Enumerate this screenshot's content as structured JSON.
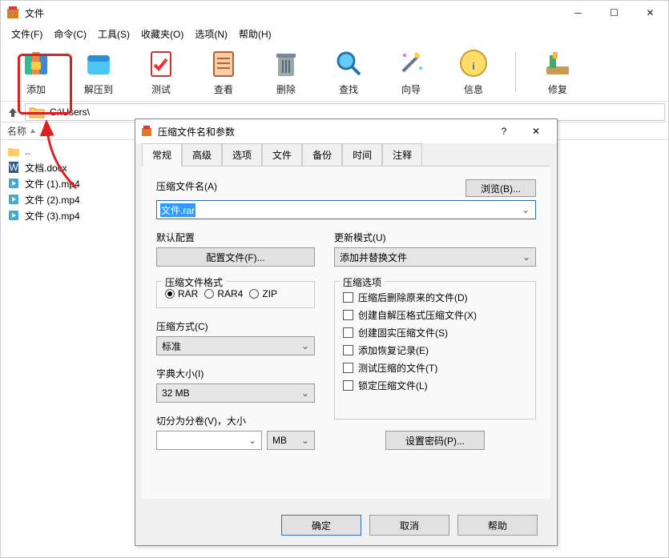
{
  "window": {
    "title": "文件"
  },
  "menu": {
    "file": "文件(F)",
    "cmd": "命令(C)",
    "tool": "工具(S)",
    "fav": "收藏夹(O)",
    "opt": "选项(N)",
    "help": "帮助(H)"
  },
  "toolbar": {
    "add": "添加",
    "extract": "解压到",
    "test": "测试",
    "view": "查看",
    "delete": "删除",
    "find": "查找",
    "wizard": "向导",
    "info": "信息",
    "repair": "修复"
  },
  "path": "C:\\Users\\",
  "list_header": "名称",
  "files": [
    {
      "name": ".."
    },
    {
      "name": "文档.docx"
    },
    {
      "name": "文件 (1).mp4"
    },
    {
      "name": "文件 (2).mp4"
    },
    {
      "name": "文件 (3).mp4"
    }
  ],
  "dialog": {
    "title": "压缩文件名和参数",
    "tabs": {
      "general": "常规",
      "adv": "高级",
      "option": "选项",
      "file": "文件",
      "backup": "备份",
      "time": "时间",
      "comment": "注释"
    },
    "filename_label": "压缩文件名(A)",
    "browse": "浏览(B)...",
    "filename_value": "文件.rar",
    "default_profile": "默认配置",
    "profiles_btn": "配置文件(F)...",
    "update_mode": "更新模式(U)",
    "update_value": "添加并替换文件",
    "fmt_label": "压缩文件格式",
    "fmt_rar": "RAR",
    "fmt_rar4": "RAR4",
    "fmt_zip": "ZIP",
    "method_label": "压缩方式(C)",
    "method_value": "标准",
    "dict_label": "字典大小(I)",
    "dict_value": "32 MB",
    "split_label": "切分为分卷(V)，大小",
    "split_unit": "MB",
    "opts_label": "压缩选项",
    "opt1": "压缩后删除原来的文件(D)",
    "opt2": "创建自解压格式压缩文件(X)",
    "opt3": "创建固实压缩文件(S)",
    "opt4": "添加恢复记录(E)",
    "opt5": "测试压缩的文件(T)",
    "opt6": "锁定压缩文件(L)",
    "setpw": "设置密码(P)...",
    "ok": "确定",
    "cancel": "取消",
    "help": "帮助"
  }
}
